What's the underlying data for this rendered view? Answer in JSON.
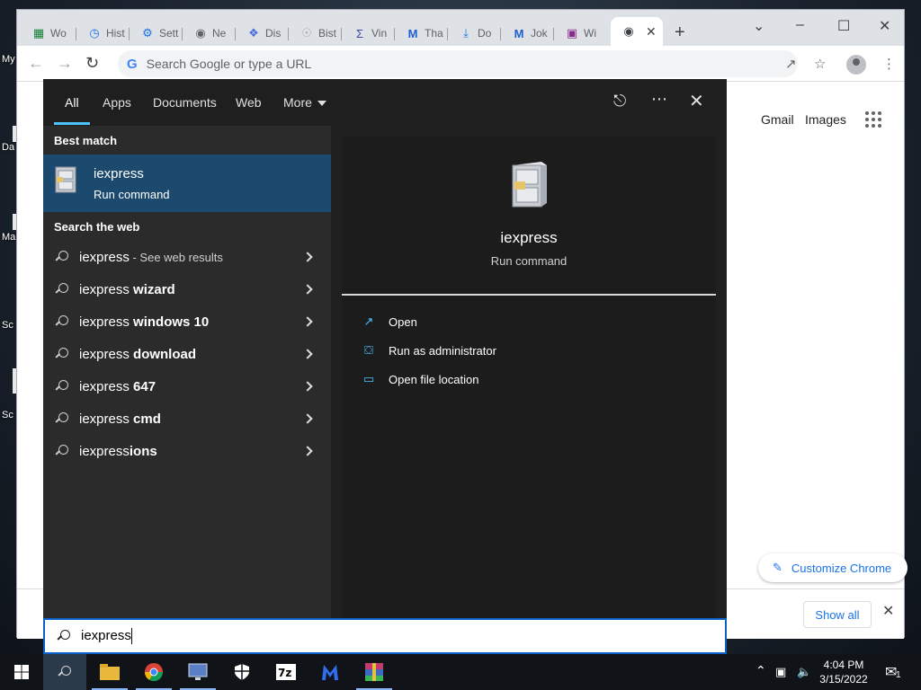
{
  "desktop": {
    "labels": [
      "My",
      "Da",
      "Ma",
      "Sc",
      "Sc"
    ]
  },
  "browser": {
    "tabs": [
      {
        "label": "Wo",
        "icon": "spreadsheet-icon",
        "color": "#188038"
      },
      {
        "label": "Hist",
        "icon": "history-icon",
        "color": "#1a73e8"
      },
      {
        "label": "Sett",
        "icon": "gear-icon",
        "color": "#1a73e8"
      },
      {
        "label": "Ne",
        "icon": "chrome-icon",
        "color": "#5f6368"
      },
      {
        "label": "Dis",
        "icon": "discourse-icon",
        "color": "#4a6fd8"
      },
      {
        "label": "Bist",
        "icon": "bist-icon",
        "color": "#aaaaaa"
      },
      {
        "label": "Vin",
        "icon": "sigma-icon",
        "color": "#3b4aa6"
      },
      {
        "label": "Tha",
        "icon": "malwarebytes-icon",
        "color": "#1e5fd0"
      },
      {
        "label": "Do",
        "icon": "download-icon",
        "color": "#1a73e8"
      },
      {
        "label": "Jok",
        "icon": "malwarebytes-icon",
        "color": "#1e5fd0"
      },
      {
        "label": "Wi",
        "icon": "winrar-icon",
        "color": "#8a2a8a"
      }
    ],
    "omnibox_placeholder": "Search Google or type a URL",
    "gmail": "Gmail",
    "images": "Images",
    "customize": "Customize Chrome",
    "show_all": "Show all"
  },
  "search_panel": {
    "tabs": {
      "all": "All",
      "apps": "Apps",
      "documents": "Documents",
      "web": "Web",
      "more": "More"
    },
    "best_match_header": "Best match",
    "best_match": {
      "title": "iexpress",
      "subtitle": "Run command"
    },
    "web_header": "Search the web",
    "web_results": [
      {
        "prefix": "iexpress",
        "bold": "",
        "hint": " - See web results"
      },
      {
        "prefix": "iexpress ",
        "bold": "wizard",
        "hint": ""
      },
      {
        "prefix": "iexpress ",
        "bold": "windows 10",
        "hint": ""
      },
      {
        "prefix": "iexpress ",
        "bold": "download",
        "hint": ""
      },
      {
        "prefix": "iexpress ",
        "bold": "647",
        "hint": ""
      },
      {
        "prefix": "iexpress ",
        "bold": "cmd",
        "hint": ""
      },
      {
        "prefix": "iexpress",
        "bold": "ions",
        "hint": ""
      }
    ],
    "preview": {
      "title": "iexpress",
      "subtitle": "Run command"
    },
    "actions": [
      "Open",
      "Run as administrator",
      "Open file location"
    ],
    "query": "iexpress",
    "accent": "#4cc2ff",
    "selection_color": "#1c4a6e"
  },
  "taskbar": {
    "time": "4:04 PM",
    "date": "3/15/2022",
    "notification_count": "1"
  }
}
